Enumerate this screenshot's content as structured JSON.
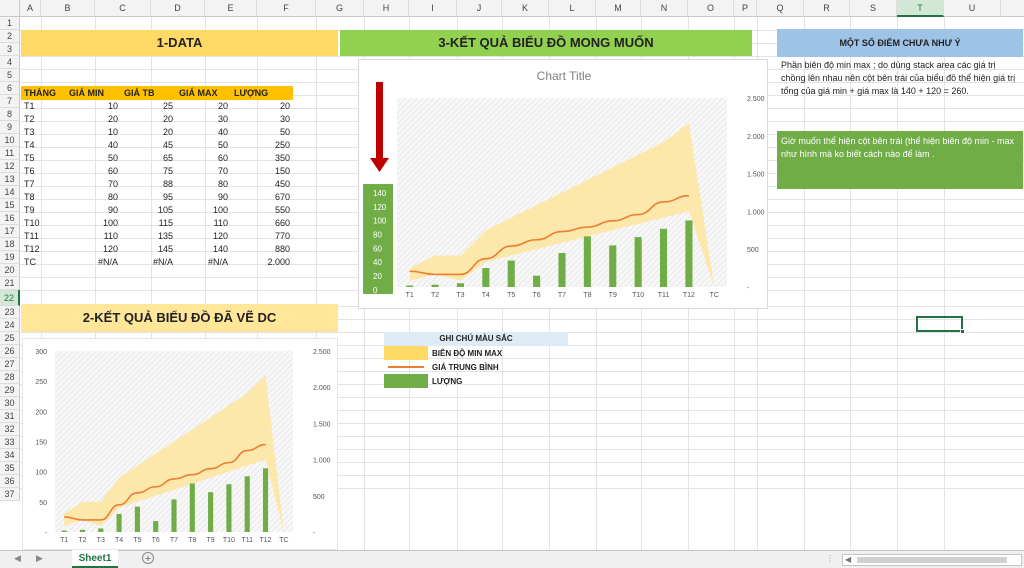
{
  "columns": [
    "A",
    "B",
    "C",
    "D",
    "E",
    "F",
    "G",
    "H",
    "I",
    "J",
    "K",
    "L",
    "M",
    "N",
    "O",
    "P",
    "Q",
    "R",
    "S",
    "T",
    "U"
  ],
  "rows": [
    "1",
    "2",
    "3",
    "4",
    "5",
    "6",
    "7",
    "8",
    "9",
    "10",
    "11",
    "12",
    "13",
    "14",
    "15",
    "16",
    "17",
    "18",
    "19",
    "20",
    "21",
    "22",
    "23",
    "24",
    "25",
    "26",
    "27",
    "28",
    "29",
    "30",
    "31",
    "32",
    "33",
    "34",
    "35",
    "36",
    "37"
  ],
  "selected_column": "T",
  "selected_row": "22",
  "banners": {
    "data": "1-DATA",
    "desired": "3-KẾT QUẢ BIỂU ĐỒ MONG MUỐN",
    "drawn": "2-KẾT QUẢ BIỂU ĐỒ ĐÃ VẼ DC",
    "notes_title": "MỘT SỐ ĐIỂM CHƯA NHƯ Ý"
  },
  "table": {
    "headers": [
      "THÁNG",
      "GIÁ MIN",
      "GIÁ TB",
      "GIÁ MAX",
      "LƯỢNG"
    ],
    "rows": [
      [
        "T1",
        "10",
        "25",
        "20",
        "20"
      ],
      [
        "T2",
        "20",
        "20",
        "30",
        "30"
      ],
      [
        "T3",
        "10",
        "20",
        "40",
        "50"
      ],
      [
        "T4",
        "40",
        "45",
        "50",
        "250"
      ],
      [
        "T5",
        "50",
        "65",
        "60",
        "350"
      ],
      [
        "T6",
        "60",
        "75",
        "70",
        "150"
      ],
      [
        "T7",
        "70",
        "88",
        "80",
        "450"
      ],
      [
        "T8",
        "80",
        "95",
        "90",
        "670"
      ],
      [
        "T9",
        "90",
        "105",
        "100",
        "550"
      ],
      [
        "T10",
        "100",
        "115",
        "110",
        "660"
      ],
      [
        "T11",
        "110",
        "135",
        "120",
        "770"
      ],
      [
        "T12",
        "120",
        "145",
        "140",
        "880"
      ],
      [
        "TC",
        "#N/A",
        "#N/A",
        "#N/A",
        "2.000"
      ]
    ]
  },
  "notes": {
    "text1": "Phần biên độ min max ; do dùng stack area  các giá trị chồng lên nhau nên cột bên trái của biểu đồ thể hiện giá trị tổng của giá min + giá max là 140 + 120 = 260.",
    "text2": "Giờ muốn thể hiện cột bên trái (thể hiện biên độ  min - max như hình mà ko biết cách nào để làm ."
  },
  "legend": {
    "title": "GHI CHÚ MÀU SẮC",
    "items": [
      "BIÊN ĐỘ MIN MAX",
      "GIÁ TRUNG BÌNH",
      "LƯỢNG"
    ]
  },
  "colors": {
    "band": "#fde7a6",
    "banner_yellow": "#ffd966",
    "banner_green": "#92d050",
    "line": "#ed7d31",
    "bar": "#70ad47",
    "notes_blue": "#9dc3e6",
    "notes_green": "#70ad47",
    "legend_header": "#ddebf7",
    "arrow": "#c00000"
  },
  "sheet_tab": "Sheet1",
  "icons": [
    "nav-left-icon",
    "nav-right-icon",
    "add-sheet-icon"
  ],
  "chart_data": [
    {
      "type": "area",
      "title": "Chart Title",
      "categories": [
        "T1",
        "T2",
        "T3",
        "T4",
        "T5",
        "T6",
        "T7",
        "T8",
        "T9",
        "T10",
        "T11",
        "T12",
        "TC"
      ],
      "series": [
        {
          "name": "BIÊN ĐỘ MIN MAX",
          "type": "area",
          "low": [
            10,
            20,
            10,
            40,
            50,
            60,
            70,
            80,
            90,
            100,
            110,
            120,
            0
          ],
          "high": [
            30,
            50,
            50,
            90,
            110,
            130,
            150,
            170,
            190,
            210,
            230,
            260,
            0
          ]
        },
        {
          "name": "GIÁ TRUNG BÌNH",
          "type": "line",
          "values": [
            25,
            20,
            20,
            45,
            65,
            75,
            88,
            95,
            105,
            115,
            135,
            145
          ]
        },
        {
          "name": "LƯỢNG",
          "type": "bar",
          "axis": "secondary",
          "values": [
            20,
            30,
            50,
            250,
            350,
            150,
            450,
            670,
            550,
            660,
            770,
            880
          ]
        }
      ],
      "y2_ticks": [
        "2.500",
        "2.000",
        "1.500",
        "1.000",
        "500",
        "-"
      ],
      "y2lim": [
        0,
        2500
      ],
      "left_axis_ticks": [
        "140",
        "120",
        "100",
        "80",
        "60",
        "40",
        "20",
        "0"
      ],
      "grid": false
    },
    {
      "type": "area",
      "title": "",
      "categories": [
        "T1",
        "T2",
        "T3",
        "T4",
        "T5",
        "T6",
        "T7",
        "T8",
        "T9",
        "T10",
        "T11",
        "T12",
        "TC"
      ],
      "series": [
        {
          "name": "BIÊN ĐỘ MIN MAX",
          "type": "area",
          "low": [
            10,
            20,
            10,
            40,
            50,
            60,
            70,
            80,
            90,
            100,
            110,
            120,
            0
          ],
          "high": [
            30,
            50,
            50,
            90,
            110,
            130,
            150,
            170,
            190,
            210,
            230,
            260,
            0
          ]
        },
        {
          "name": "GIÁ TRUNG BÌNH",
          "type": "line",
          "values": [
            25,
            20,
            20,
            45,
            65,
            75,
            88,
            95,
            105,
            115,
            135,
            145
          ]
        },
        {
          "name": "LƯỢNG",
          "type": "bar",
          "axis": "secondary",
          "values": [
            20,
            30,
            50,
            250,
            350,
            150,
            450,
            670,
            550,
            660,
            770,
            880
          ]
        }
      ],
      "y_ticks": [
        "300",
        "250",
        "200",
        "150",
        "100",
        "50",
        "-"
      ],
      "ylim": [
        0,
        300
      ],
      "y2_ticks": [
        "2.500",
        "2.000",
        "1.500",
        "1.000",
        "500",
        "-"
      ],
      "y2lim": [
        0,
        2500
      ],
      "grid": false
    }
  ]
}
